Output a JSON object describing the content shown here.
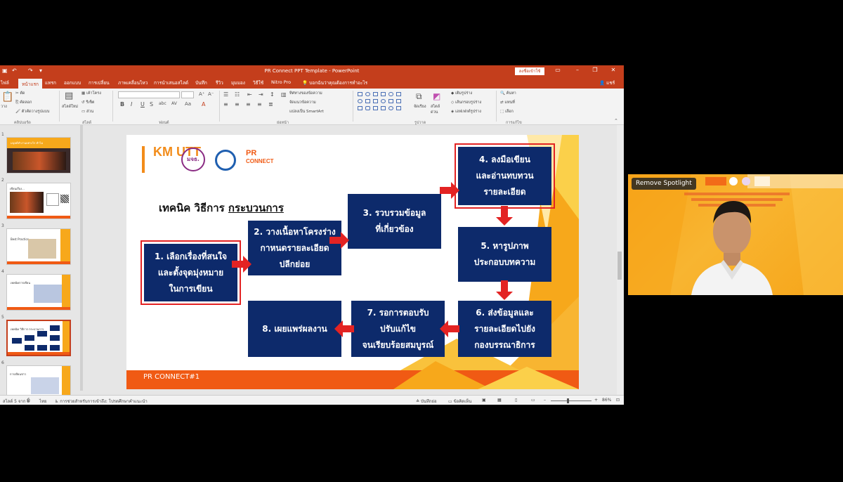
{
  "window": {
    "title": "PR Connect PPT Template  -  PowerPoint",
    "signin": "ลงชื่อเข้าใช้",
    "share": "แชร์"
  },
  "quick_access": {
    "save_icon": "save-icon",
    "undo_icon": "undo-icon",
    "redo_icon": "redo-icon"
  },
  "tabs": [
    {
      "label": "ไฟล์"
    },
    {
      "label": "หน้าแรก"
    },
    {
      "label": "แทรก"
    },
    {
      "label": "ออกแบบ"
    },
    {
      "label": "การเปลี่ยน"
    },
    {
      "label": "ภาพเคลื่อนไหว"
    },
    {
      "label": "การนำเสนอสไลด์"
    },
    {
      "label": "บันทึก"
    },
    {
      "label": "รีวิว"
    },
    {
      "label": "มุมมอง"
    },
    {
      "label": "วิธีใช้"
    },
    {
      "label": "Nitro Pro"
    }
  ],
  "tell_me": "บอกฉันว่าคุณต้องการทำอะไร",
  "ribbon": {
    "clipboard": {
      "cut": "ตัด",
      "copy": "คัดลอก",
      "format_painter": "ตัวคัดวางรูปแบบ",
      "paste": "วาง",
      "group": "คลิปบอร์ด"
    },
    "slides": {
      "new_slide": "สไลด์ใหม่",
      "layout": "เค้าโครง",
      "reset": "รีเซ็ต",
      "section": "ส่วน",
      "group": "สไลด์"
    },
    "font": {
      "group": "ฟอนต์"
    },
    "paragraph": {
      "text_direction": "ทิศทางของข้อความ",
      "align_text": "จัดแนวข้อความ",
      "smartart": "แปลงเป็น SmartArt",
      "group": "ย่อหน้า"
    },
    "drawing": {
      "arrange": "จัดเรียง",
      "quick_styles": "สไตล์ด่วน",
      "shape_fill": "เติมรูปร่าง",
      "shape_outline": "เส้นกรอบรูปร่าง",
      "shape_effects": "เอฟเฟกต์รูปร่าง",
      "group": "รูปวาด"
    },
    "editing": {
      "find": "ค้นหา",
      "replace": "แทนที่",
      "select": "เลือก",
      "group": "การแก้ไข"
    }
  },
  "thumbnails": [
    {
      "num": "1",
      "caption": "มนุษย์ทำงานอย่างไร ทำไม"
    },
    {
      "num": "2",
      "caption": "เขียนเรื่อง..."
    },
    {
      "num": "3",
      "caption": "Best Practice"
    },
    {
      "num": "4",
      "caption": "เทคนิคการเขียน"
    },
    {
      "num": "5",
      "caption": "เทคนิค วิธีการ กระบวนการ"
    },
    {
      "num": "6",
      "caption": "การเขียนข่าว"
    }
  ],
  "slide": {
    "logos": {
      "kmutt": "KM UTT",
      "thai": "มจธ.",
      "pr": "PR",
      "connect": "CONNECT"
    },
    "title_prefix": "เทคนิค วิธีการ ",
    "title_underlined": "กระบวนการ",
    "steps": [
      {
        "id": "1",
        "lines": [
          "1. เลือกเรื่องที่สนใจ",
          "และตั้งจุดมุ่งหมาย",
          "ในการเขียน"
        ]
      },
      {
        "id": "2",
        "lines": [
          "2. วางเนื้อหาโครงร่าง",
          "กาหนดรายละเอียด",
          "ปลีกย่อย"
        ]
      },
      {
        "id": "3",
        "lines": [
          "3. รวบรวมข้อมูล",
          "ที่เกี่ยวข้อง"
        ]
      },
      {
        "id": "4",
        "lines": [
          "4. ลงมือเขียน",
          "และอ่านทบทวน",
          "รายละเอียด"
        ]
      },
      {
        "id": "5",
        "lines": [
          "5. หารูปภาพ",
          "ประกอบบทความ"
        ]
      },
      {
        "id": "6",
        "lines": [
          "6. ส่งข้อมูลและ",
          "รายละเอียดไปยัง",
          "กองบรรณาธิการ"
        ]
      },
      {
        "id": "7",
        "lines": [
          "7. รอการตอบรับ",
          "ปรับแก้ไข",
          "จนเรียบร้อยสมบูรณ์"
        ]
      },
      {
        "id": "8",
        "lines": [
          "8. เผยแพร่ผลงาน"
        ]
      }
    ],
    "footer": "PR CONNECT#1"
  },
  "statusbar": {
    "slide_info": "สไลด์ 5 จาก 8",
    "language": "ไทย",
    "accessibility": "การช่วยสำหรับการเข้าถึง: โปรดศึกษาคำแนะนำ",
    "notes": "บันทึกย่อ",
    "comments": "ข้อคิดเห็น",
    "zoom": "86%"
  },
  "video": {
    "remove_spotlight": "Remove Spotlight"
  },
  "colors": {
    "ppt_accent": "#c43e1c",
    "box_navy": "#0d2a6b",
    "arrow_red": "#e32323",
    "slide_orange": "#f7a81b"
  }
}
